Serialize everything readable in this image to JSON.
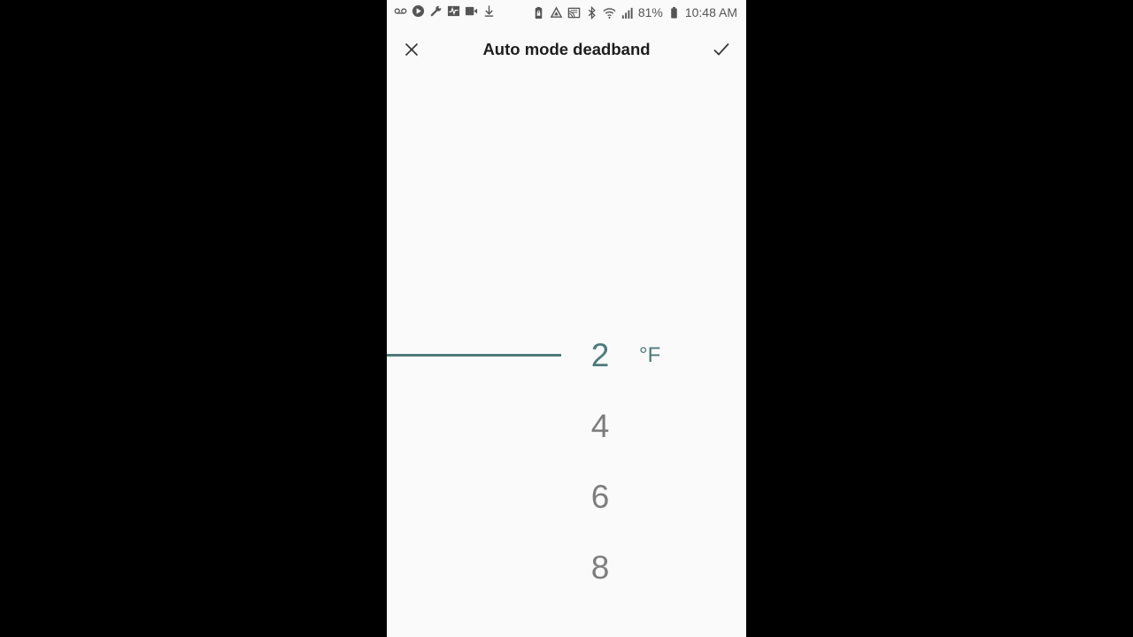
{
  "status_bar": {
    "battery_percent": "81%",
    "time": "10:48 AM",
    "left_icons": [
      "voicemail-icon",
      "play-store-icon",
      "wrench-icon",
      "activity-icon",
      "video-icon",
      "download-icon"
    ],
    "right_icons": [
      "battery-lock-icon",
      "recycle-icon",
      "cast-icon",
      "bluetooth-icon",
      "wifi-icon",
      "signal-icon",
      "battery-icon"
    ]
  },
  "app_bar": {
    "title": "Auto mode deadband",
    "close_icon": "close-icon",
    "confirm_icon": "check-icon"
  },
  "picker": {
    "items": [
      "2",
      "4",
      "6",
      "8"
    ],
    "selected": "2",
    "unit": "°F"
  },
  "colors": {
    "accent": "#4f7a7a",
    "unselected": "#7d7d7d",
    "background": "#fafafa",
    "title": "#1e1e1e"
  }
}
